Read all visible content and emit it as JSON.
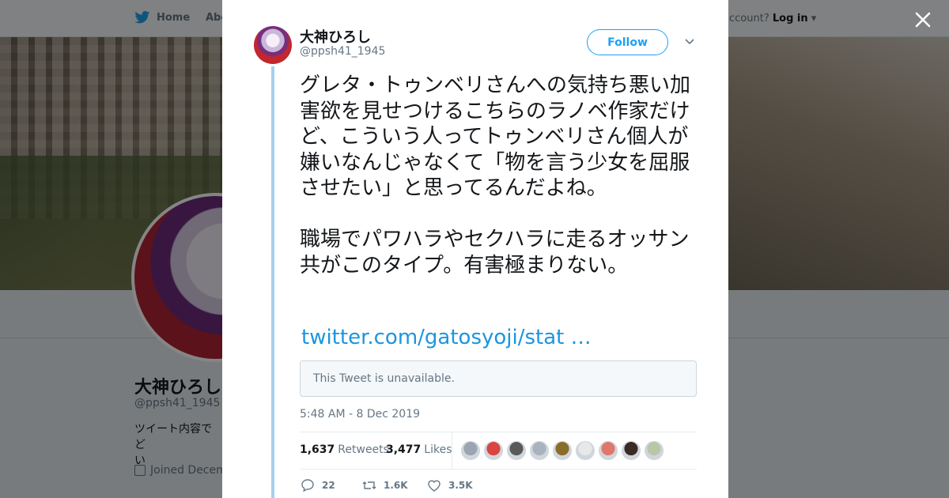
{
  "background_page": {
    "nav_home": "Home",
    "nav_about": "Abo",
    "account_prompt": "ccount?",
    "login": "Log in",
    "profile_name": "大神ひろし",
    "profile_handle": "@ppsh41_1945",
    "bio": "ツイート内容でど\nい",
    "joined": "Joined Decem"
  },
  "modal": {
    "author": {
      "name": "大神ひろし",
      "handle": "@ppsh41_1945"
    },
    "follow_label": "Follow",
    "tweet_text": "グレタ・トゥンベリさんへの気持ち悪い加害欲を見せつけるこちらのラノベ作家だけど、こういう人ってトゥンベリさん個人が嫌いなんじゃなくて「物を言う少女を屈服させたい」と思ってるんだよね。\n\n職場でパワハラやセクハラに走るオッサン共がこのタイプ。有害極まりない。",
    "link_text": "twitter.com/gatosyoji/stat …",
    "quoted_unavailable": "This Tweet is unavailable.",
    "timestamp": "5:48 AM - 8 Dec 2019",
    "stats": {
      "retweets_count": "1,637",
      "retweets_label": "Retweets",
      "likes_count": "3,477",
      "likes_label": "Likes"
    },
    "liker_colors": [
      "#9aa5b1",
      "#d9453f",
      "#5a5a5a",
      "#aab3bd",
      "#8a6d2a",
      "#e8e8e8",
      "#e0776b",
      "#3b2a24",
      "#b9c7a8"
    ],
    "actions": {
      "replies": "22",
      "retweets": "1.6K",
      "likes": "3.5K"
    }
  },
  "colors": {
    "brand_blue": "#1da1f2",
    "link_blue": "#1b95e0",
    "thread_line": "#a4d1ee"
  }
}
